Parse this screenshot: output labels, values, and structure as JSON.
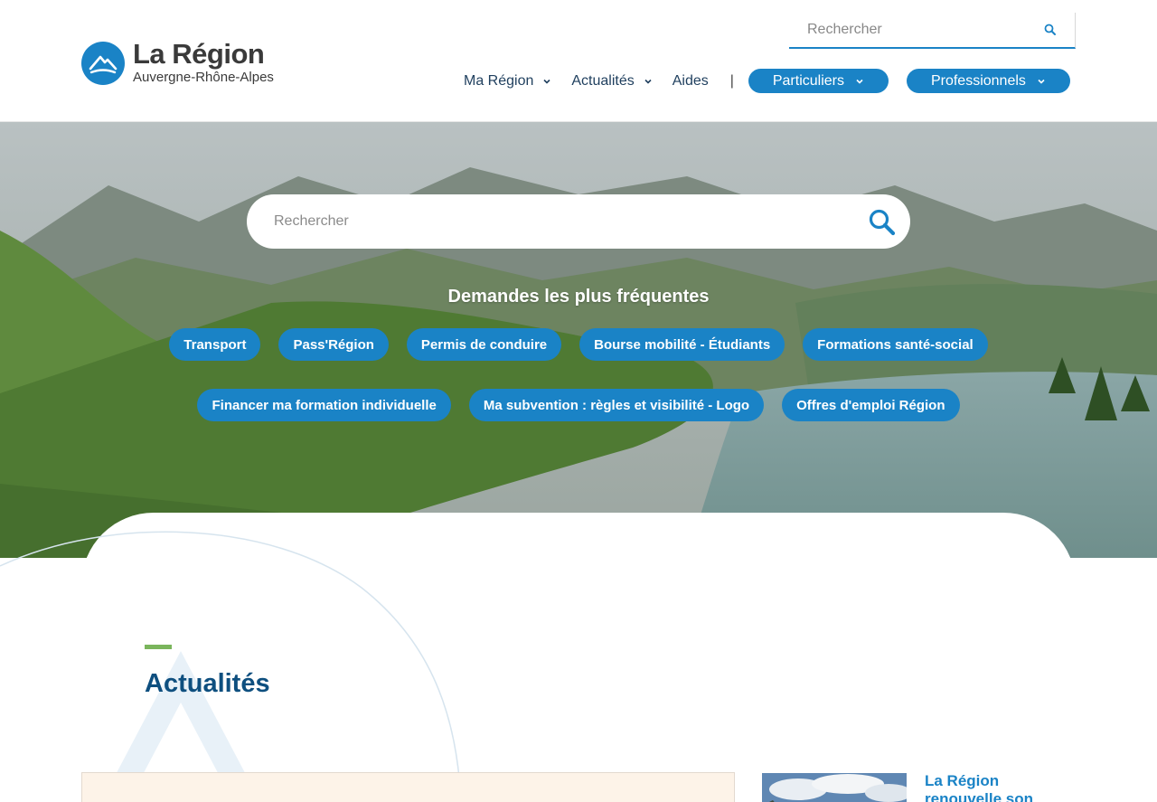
{
  "header": {
    "logo": {
      "line1": "La Région",
      "line2": "Auvergne-Rhône-Alpes"
    },
    "search": {
      "placeholder": "Rechercher"
    },
    "nav": {
      "ma_region": "Ma Région",
      "actualites": "Actualités",
      "aides": "Aides",
      "separator": "|",
      "particuliers": "Particuliers",
      "professionnels": "Professionnels"
    }
  },
  "hero": {
    "search": {
      "placeholder": "Rechercher"
    },
    "frequent_title": "Demandes les plus fréquentes",
    "frequent_requests": [
      "Transport",
      "Pass'Région",
      "Permis de conduire",
      "Bourse mobilité - Étudiants",
      "Formations santé-social",
      "Financer ma formation individuelle",
      "Ma subvention : règles et visibilité - Logo",
      "Offres d'emploi Région"
    ]
  },
  "news": {
    "section_title": "Actualités",
    "item_title": "La Région renouvelle son soutien aux"
  },
  "colors": {
    "brand_blue": "#1a83c6",
    "title_navy": "#0e4f7f",
    "accent_green": "#7ab55c"
  },
  "icons": [
    "search-icon",
    "chevron-down-icon",
    "region-logo-icon"
  ]
}
